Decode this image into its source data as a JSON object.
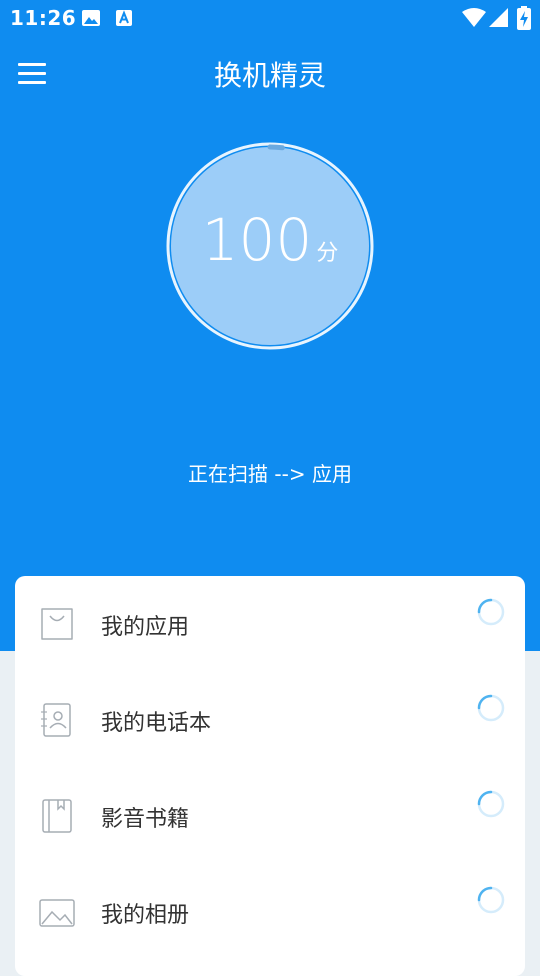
{
  "status_bar": {
    "time": "11:26",
    "icons": [
      "image-icon",
      "text-a-icon",
      "wifi-icon",
      "signal-icon",
      "battery-charging-icon"
    ]
  },
  "app_bar": {
    "title": "换机精灵",
    "menu_icon": "hamburger-menu-icon"
  },
  "score": {
    "value": "100",
    "unit": "分",
    "progress_fraction": 0.02
  },
  "scan_status": "正在扫描 --> 应用",
  "items": [
    {
      "label": "我的应用",
      "icon": "shopping-bag-icon"
    },
    {
      "label": "我的电话本",
      "icon": "contacts-book-icon"
    },
    {
      "label": "影音书籍",
      "icon": "book-icon"
    },
    {
      "label": "我的相册",
      "icon": "photo-album-icon"
    }
  ],
  "colors": {
    "primary": "#0f8cf0",
    "circle_fill": "#9ccdf8",
    "spinner": "#4fb3f0",
    "page_bg": "#eaf0f4"
  }
}
